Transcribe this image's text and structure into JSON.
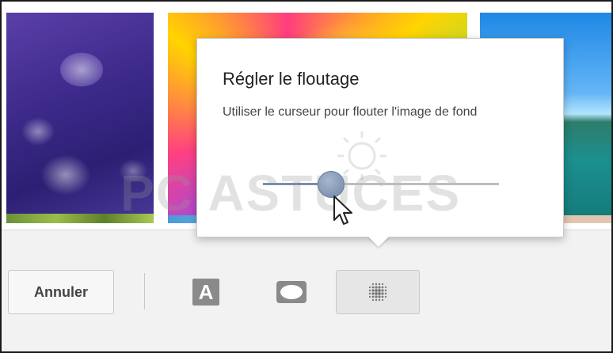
{
  "popup": {
    "title": "Régler le floutage",
    "description": "Utiliser le curseur pour flouter l'image de fond",
    "slider_value": 0.29
  },
  "toolbar": {
    "cancel_label": "Annuler",
    "text_tool_letter": "A",
    "tools": [
      "text-tool",
      "shape-tool",
      "blur-tool"
    ],
    "active_tool": "blur-tool"
  },
  "watermark": {
    "text": "PC ASTUCES"
  },
  "colors": {
    "slider_thumb": "#8196b5",
    "active_tool_bg": "#e6e6e6",
    "toolbar_bg": "#f2f2f2"
  }
}
